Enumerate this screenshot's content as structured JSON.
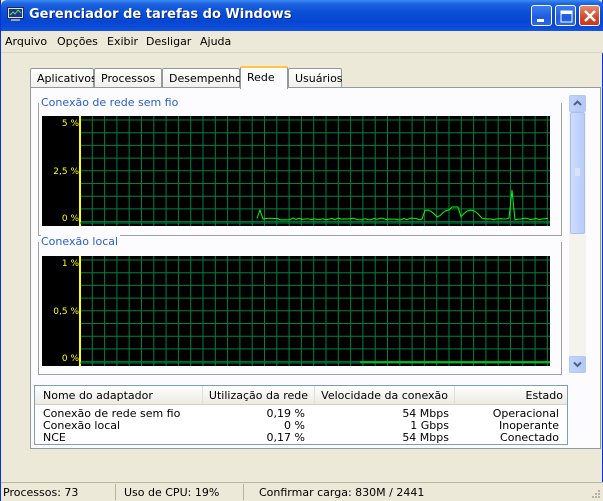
{
  "window": {
    "title": "Gerenciador de tarefas do Windows"
  },
  "menu": {
    "items": [
      "Arquivo",
      "Opções",
      "Exibir",
      "Desligar",
      "Ajuda"
    ]
  },
  "tabs": {
    "items": [
      "Aplicativos",
      "Processos",
      "Desempenho",
      "Rede",
      "Usuários"
    ],
    "active": "Rede"
  },
  "graphs": [
    {
      "label": "Conexão de rede sem fio",
      "y_labels": [
        "5 %",
        "2,5 %",
        "0 %"
      ],
      "color": "#00ff00"
    },
    {
      "label": "Conexão local",
      "y_labels": [
        "1 %",
        "0,5 %",
        "0 %"
      ],
      "color": "#00ff00"
    }
  ],
  "adapters": {
    "columns": [
      "Nome do adaptador",
      "Utilização da rede",
      "Velocidade da conexão",
      "Estado"
    ],
    "rows": [
      {
        "name": "Conexão de rede sem fio",
        "utilization": "0,19 %",
        "speed": "54 Mbps",
        "state": "Operacional"
      },
      {
        "name": "Conexão local",
        "utilization": "0 %",
        "speed": "1 Gbps",
        "state": "Inoperante"
      },
      {
        "name": "NCE",
        "utilization": "0,17 %",
        "speed": "54 Mbps",
        "state": "Conectado"
      }
    ]
  },
  "status": {
    "processes": "Processos: 73",
    "cpu": "Uso de CPU: 19%",
    "commit": "Confirmar carga: 830M / 2441"
  },
  "colors": {
    "titlebar": "#0a4fd6",
    "graph_bg": "#000000",
    "grid": "#008040",
    "trace": "#00ff00",
    "axis_label": "#ffff00"
  }
}
